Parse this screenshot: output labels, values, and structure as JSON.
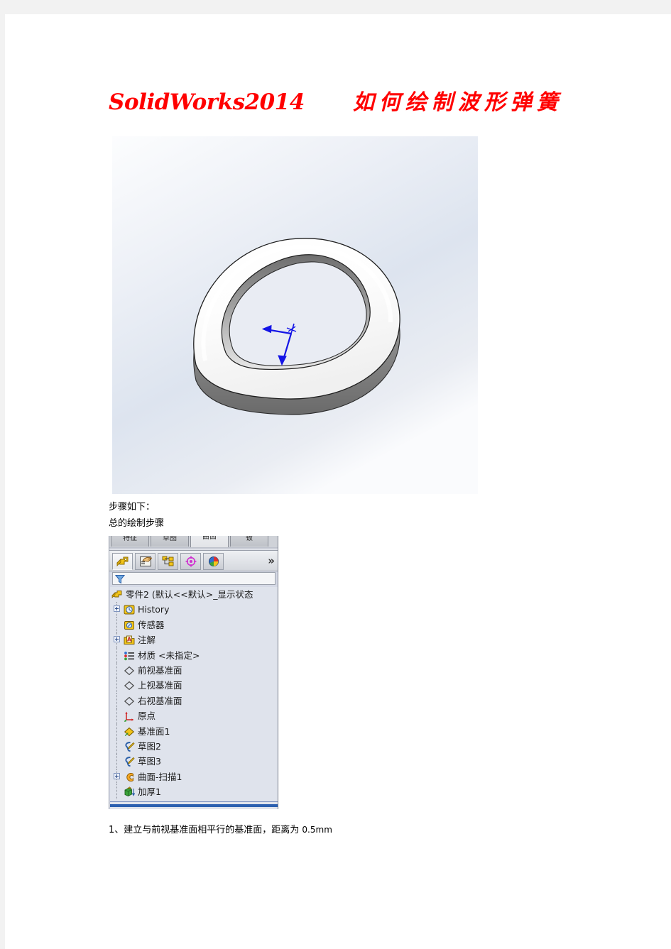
{
  "document": {
    "title_en": "SolidWorks2014",
    "title_cn": "如何绘制波形弹簧",
    "title_color": "#ff0000",
    "steps_heading": "步骤如下：",
    "overview_label": "总的绘制步骤",
    "step_1": "1、建立与前视基准面相平行的基准面，距离为 0.5mm",
    "step_1_number": "1、",
    "step_1_text": "建立与前视基准面相平行的基准面，距离为 ",
    "step_1_value": "0.5mm"
  },
  "figure": {
    "alt": "SolidWorks 三维模型视图 - 波形弹簧单圈",
    "background_top": "#fbfcfd",
    "background_bottom": "#dfe5ef",
    "origin_triad_color": "#1414e6"
  },
  "solidworks_panel": {
    "command_tabs": [
      {
        "label": "特征",
        "active": false
      },
      {
        "label": "草图",
        "active": false
      },
      {
        "label": "曲面",
        "active": true
      },
      {
        "label": "钣",
        "active": false
      },
      {
        "label": "",
        "active": false
      }
    ],
    "manager_tabs": [
      {
        "name": "feature-manager-design-tree-tab",
        "icon": "feature-tree-icon",
        "selected": true
      },
      {
        "name": "property-manager-tab",
        "icon": "property-clipboard-icon",
        "selected": false
      },
      {
        "name": "configuration-manager-tab",
        "icon": "configuration-icon",
        "selected": false
      },
      {
        "name": "dimxpert-manager-tab",
        "icon": "dimxpert-target-icon",
        "selected": false
      },
      {
        "name": "display-manager-tab",
        "icon": "display-sphere-icon",
        "selected": false
      }
    ],
    "overflow_label": "»",
    "filter_placeholder": "",
    "tree": [
      {
        "label": "零件2  (默认<<默认>_显示状态",
        "icon": "part-icon",
        "level": 0,
        "expandable": false
      },
      {
        "label": "History",
        "icon": "history-icon",
        "level": 1,
        "expandable": true
      },
      {
        "label": "传感器",
        "icon": "sensor-icon",
        "level": 1,
        "expandable": false
      },
      {
        "label": "注解",
        "icon": "annotation-icon",
        "level": 1,
        "expandable": true
      },
      {
        "label": "材质 <未指定>",
        "icon": "material-icon",
        "level": 1,
        "expandable": false
      },
      {
        "label": "前视基准面",
        "icon": "plane-icon",
        "level": 1,
        "expandable": false
      },
      {
        "label": "上视基准面",
        "icon": "plane-icon",
        "level": 1,
        "expandable": false
      },
      {
        "label": "右视基准面",
        "icon": "plane-icon",
        "level": 1,
        "expandable": false
      },
      {
        "label": "原点",
        "icon": "origin-icon",
        "level": 1,
        "expandable": false
      },
      {
        "label": "基准面1",
        "icon": "plane-yellow-icon",
        "level": 1,
        "expandable": false
      },
      {
        "label": "草图2",
        "icon": "sketch-icon",
        "level": 1,
        "expandable": false
      },
      {
        "label": "草图3",
        "icon": "sketch-icon",
        "level": 1,
        "expandable": false
      },
      {
        "label": "曲面-扫描1",
        "icon": "surface-sweep-icon",
        "level": 1,
        "expandable": true
      },
      {
        "label": "加厚1",
        "icon": "thicken-icon",
        "level": 1,
        "expandable": false
      }
    ]
  }
}
